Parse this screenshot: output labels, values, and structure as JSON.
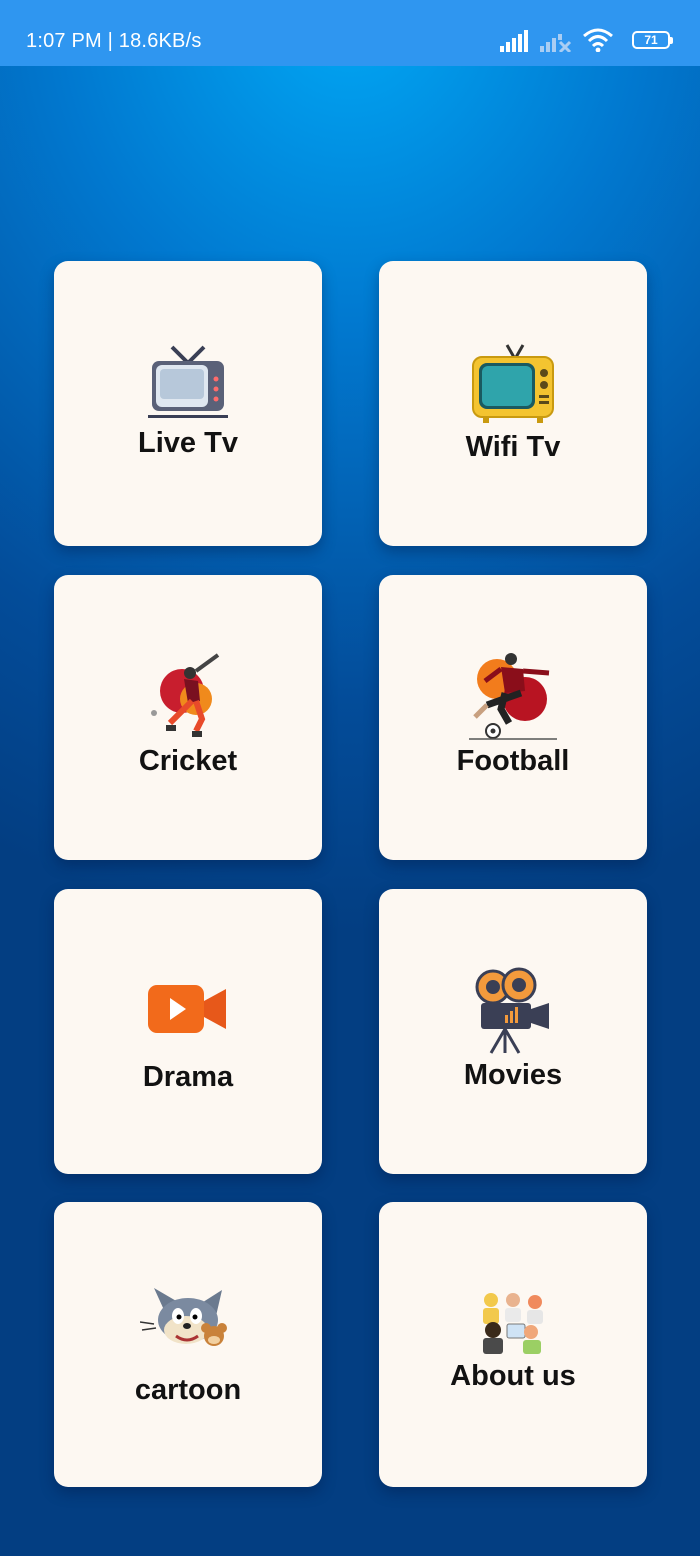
{
  "status_bar": {
    "time_speed": "1:07 PM | 18.6KB/s",
    "battery_level": "71",
    "icons": [
      "signal-icon",
      "signal-no-sim-icon",
      "wifi-icon",
      "battery-icon"
    ]
  },
  "menu": {
    "items": [
      {
        "label": "Live Tv",
        "icon": "retro-tv-icon"
      },
      {
        "label": "Wifi Tv",
        "icon": "yellow-tv-icon"
      },
      {
        "label": "Cricket",
        "icon": "cricket-player-icon"
      },
      {
        "label": "Football",
        "icon": "football-player-icon"
      },
      {
        "label": "Drama",
        "icon": "video-camera-icon"
      },
      {
        "label": "Movies",
        "icon": "movie-camera-icon"
      },
      {
        "label": "cartoon",
        "icon": "tom-and-jerry-icon"
      },
      {
        "label": "About us",
        "icon": "team-people-icon"
      }
    ]
  },
  "colors": {
    "status_bar": "#2f96f0",
    "background_top": "#01a8f5",
    "background_bottom": "#033e82",
    "card": "#fdf8f2",
    "label": "#121212"
  }
}
